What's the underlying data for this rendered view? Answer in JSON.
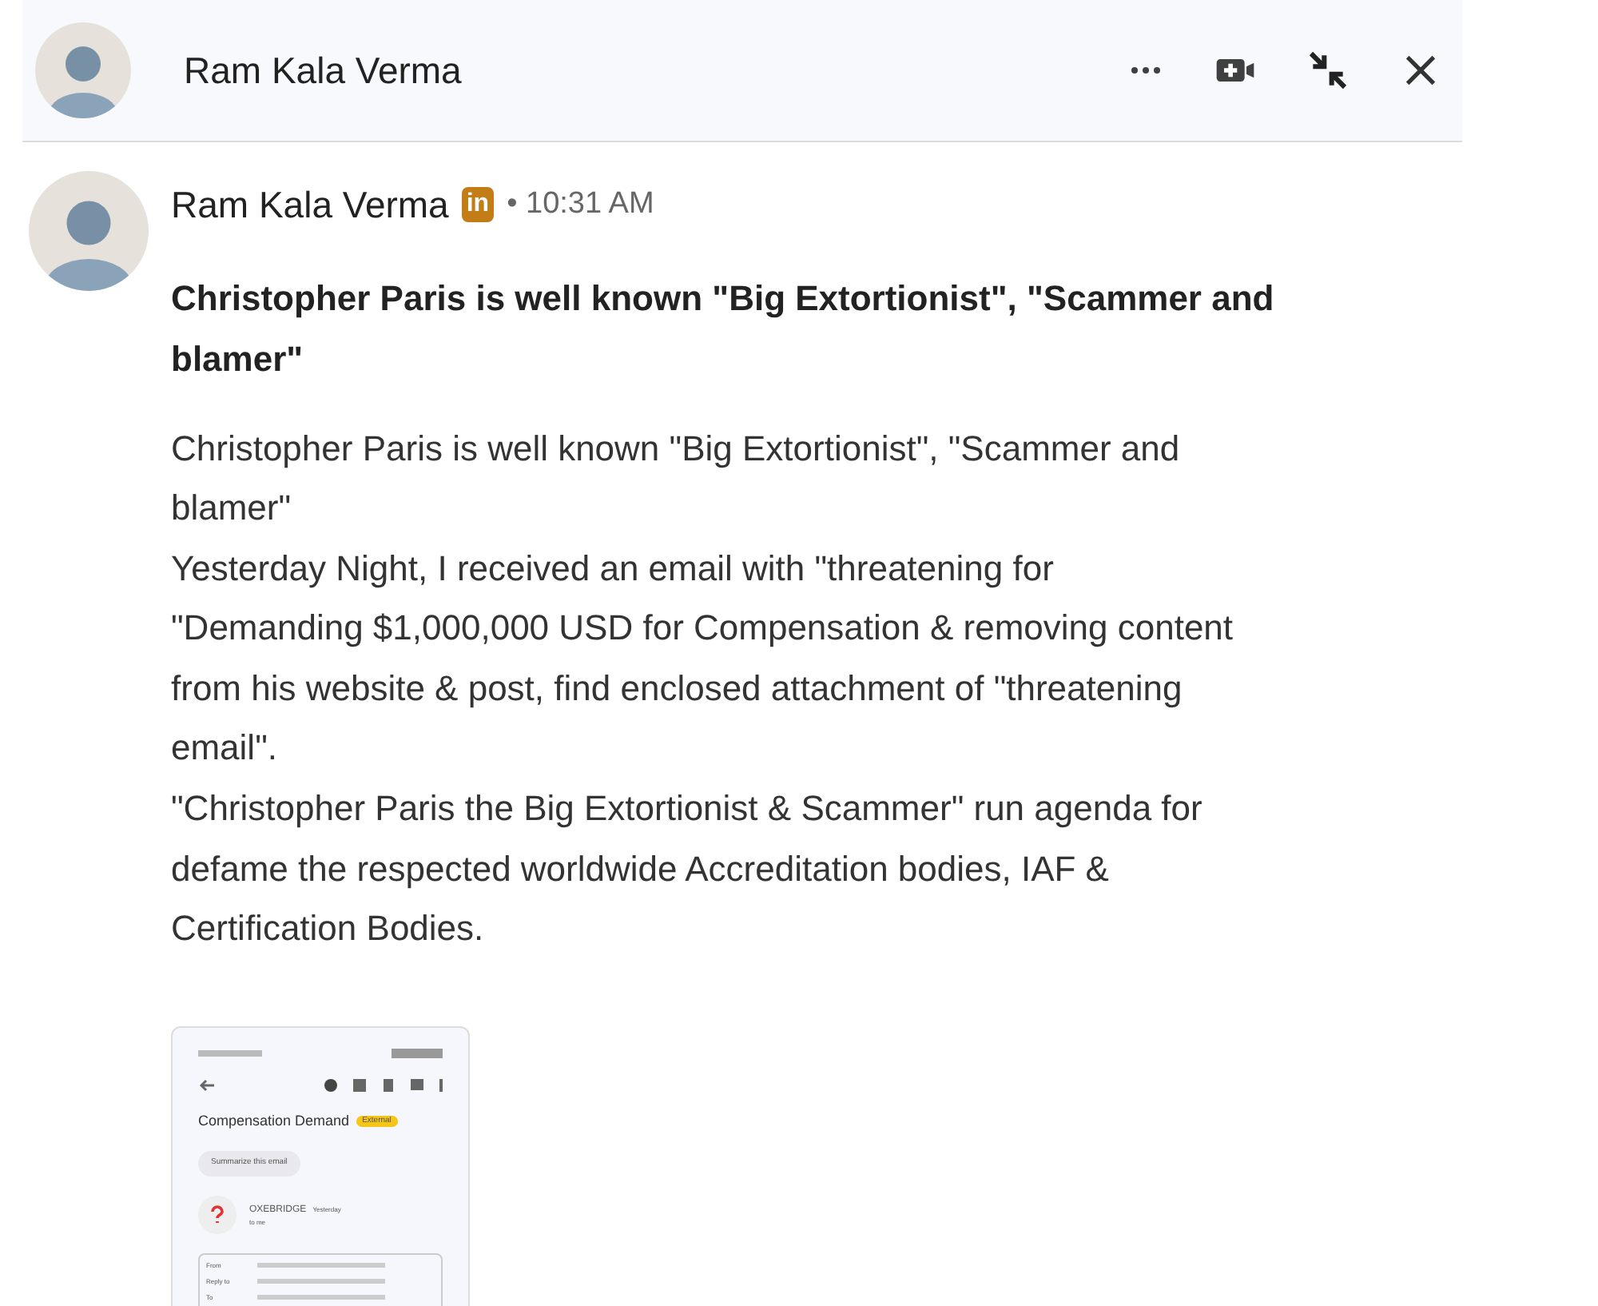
{
  "header": {
    "name": "Ram Kala Verma"
  },
  "message": {
    "sender": "Ram Kala Verma",
    "badge": "in",
    "time": "• 10:31 AM",
    "subject": "Christopher Paris is well known \"Big Extortionist\", \"Scammer and blamer\"",
    "paragraphs": [
      "Christopher Paris is well known \"Big Extortionist\", \"Scammer and blamer\"",
      "Yesterday Night, I received an email with \"threatening for \"Demanding $1,000,000 USD for Compensation & removing content from his website & post, find enclosed attachment of \"threatening email\".",
      "\"Christopher Paris the Big Extortionist & Scammer\" run agenda for defame the respected worldwide Accreditation bodies, IAF & Certification Bodies."
    ],
    "attachment": {
      "subject": "Compensation Demand",
      "tag": "External",
      "summarize": "Summarize this email",
      "from_name": "OXEBRIDGE",
      "when": "Yesterday",
      "recipient": "to me",
      "fields": [
        "From",
        "Reply to",
        "To"
      ]
    }
  }
}
